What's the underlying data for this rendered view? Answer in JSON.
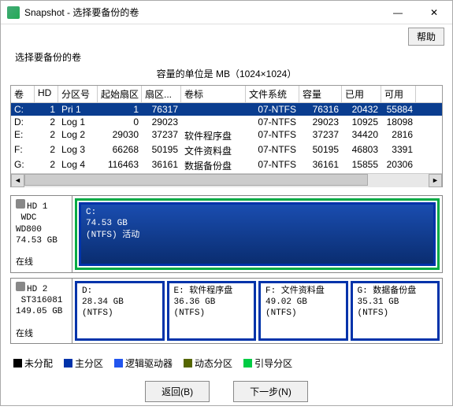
{
  "window": {
    "title": "Snapshot - 选择要备份的卷",
    "help": "帮助",
    "minimize": "—",
    "close": "✕"
  },
  "subtitle": "选择要备份的卷",
  "cap_unit": "容量的单位是 MB（1024×1024）",
  "cols": [
    "卷",
    "HD",
    "分区号",
    "起始扇区",
    "扇区...",
    "卷标",
    "文件系统",
    "容量",
    "已用",
    "可用"
  ],
  "rows": [
    {
      "sel": true,
      "c": [
        "C:",
        "1",
        "Pri 1",
        "1",
        "76317",
        "",
        "07-NTFS",
        "76316",
        "20432",
        "55884"
      ]
    },
    {
      "sel": false,
      "c": [
        "D:",
        "2",
        "Log 1",
        "0",
        "29023",
        "",
        "07-NTFS",
        "29023",
        "10925",
        "18098"
      ]
    },
    {
      "sel": false,
      "c": [
        "E:",
        "2",
        "Log 2",
        "29030",
        "37237",
        "软件程序盘",
        "07-NTFS",
        "37237",
        "34420",
        "2816"
      ]
    },
    {
      "sel": false,
      "c": [
        "F:",
        "2",
        "Log 3",
        "66268",
        "50195",
        "文件资料盘",
        "07-NTFS",
        "50195",
        "46803",
        "3391"
      ]
    },
    {
      "sel": false,
      "c": [
        "G:",
        "2",
        "Log 4",
        "116463",
        "36161",
        "数据备份盘",
        "07-NTFS",
        "36161",
        "15855",
        "20306"
      ]
    }
  ],
  "disks": [
    {
      "name": "HD 1",
      "model": "WDC WD800",
      "size": "74.53 GB",
      "status": "在线",
      "parts": [
        {
          "letter": "C:",
          "size": "74.53 GB",
          "fs": "(NTFS) 活动",
          "boot": true,
          "fill": true
        }
      ]
    },
    {
      "name": "HD 2",
      "model": "ST316081",
      "size": "149.05 GB",
      "status": "在线",
      "parts": [
        {
          "letter": "D:",
          "size": "28.34 GB",
          "fs": "(NTFS)",
          "label": ""
        },
        {
          "letter": "E:",
          "size": "36.36 GB",
          "fs": "(NTFS)",
          "label": "软件程序盘"
        },
        {
          "letter": "F:",
          "size": "49.02 GB",
          "fs": "(NTFS)",
          "label": "文件资料盘"
        },
        {
          "letter": "G:",
          "size": "35.31 GB",
          "fs": "(NTFS)",
          "label": "数据备份盘"
        }
      ]
    }
  ],
  "legend": [
    {
      "color": "#000000",
      "label": "未分配"
    },
    {
      "color": "#0033aa",
      "label": "主分区"
    },
    {
      "color": "#2255ee",
      "label": "逻辑驱动器"
    },
    {
      "color": "#556600",
      "label": "动态分区"
    },
    {
      "color": "#00cc44",
      "label": "引导分区"
    }
  ],
  "buttons": {
    "back": "返回(B)",
    "next": "下一步(N)"
  }
}
